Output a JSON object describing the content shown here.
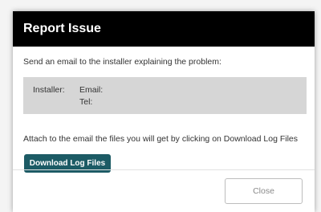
{
  "dialog": {
    "title": "Report Issue",
    "intro": "Send an email to the installer explaining the problem:",
    "installer": {
      "label": "Installer:",
      "email_label": "Email:",
      "tel_label": "Tel:"
    },
    "attach_text": "Attach to the email the files you will get by clicking on Download Log Files",
    "download_button": "Download Log Files",
    "close_button": "Close"
  },
  "colors": {
    "header_bg": "#000000",
    "primary_button": "#1c5b65",
    "info_box_bg": "#d6d6d6"
  }
}
